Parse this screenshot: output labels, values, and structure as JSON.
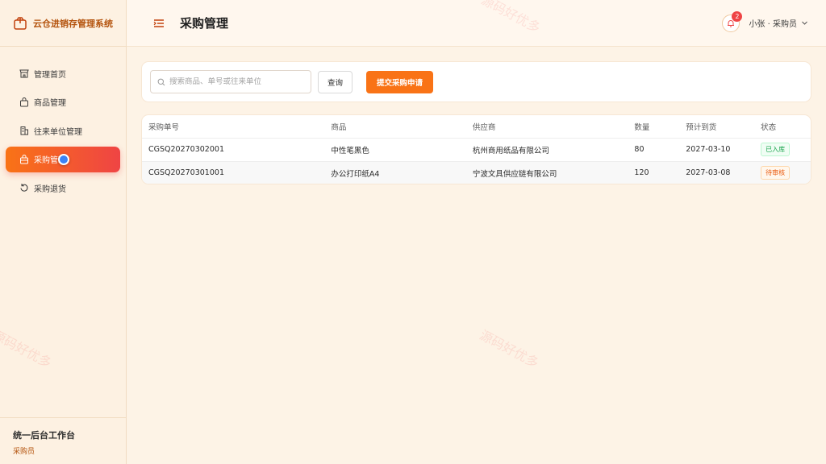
{
  "app": {
    "title": "云仓进销存管理系统"
  },
  "sidebar": {
    "items": [
      {
        "label": "管理首页",
        "icon": "storefront-icon"
      },
      {
        "label": "商品管理",
        "icon": "bag-icon"
      },
      {
        "label": "往来单位管理",
        "icon": "building-icon"
      },
      {
        "label": "采购管理",
        "icon": "purchase-icon",
        "active": true
      },
      {
        "label": "采购退货",
        "icon": "return-icon"
      }
    ],
    "footer": {
      "title": "统一后台工作台",
      "role": "采购员"
    }
  },
  "header": {
    "title": "采购管理",
    "notification_count": "2",
    "user": "小张 · 采购员"
  },
  "search": {
    "placeholder": "搜索商品、单号或往来单位",
    "query_label": "查询",
    "submit_label": "提交采购申请"
  },
  "table": {
    "headers": [
      "采购单号",
      "商品",
      "供应商",
      "数量",
      "预计到货",
      "状态"
    ],
    "rows": [
      {
        "id": "CGSQ20270302001",
        "product": "中性笔黑色",
        "supplier": "杭州商用纸品有限公司",
        "qty": "80",
        "eta": "2027-03-10",
        "status": "已入库"
      },
      {
        "id": "CGSQ20270301001",
        "product": "办公打印纸A4",
        "supplier": "宁波文具供应链有限公司",
        "qty": "120",
        "eta": "2027-03-08",
        "status": "待审核"
      }
    ]
  },
  "watermark": "源码好优多",
  "colors": {
    "accent": "#f97316",
    "accent_end": "#ef4444",
    "brand_text": "#b4530d"
  }
}
